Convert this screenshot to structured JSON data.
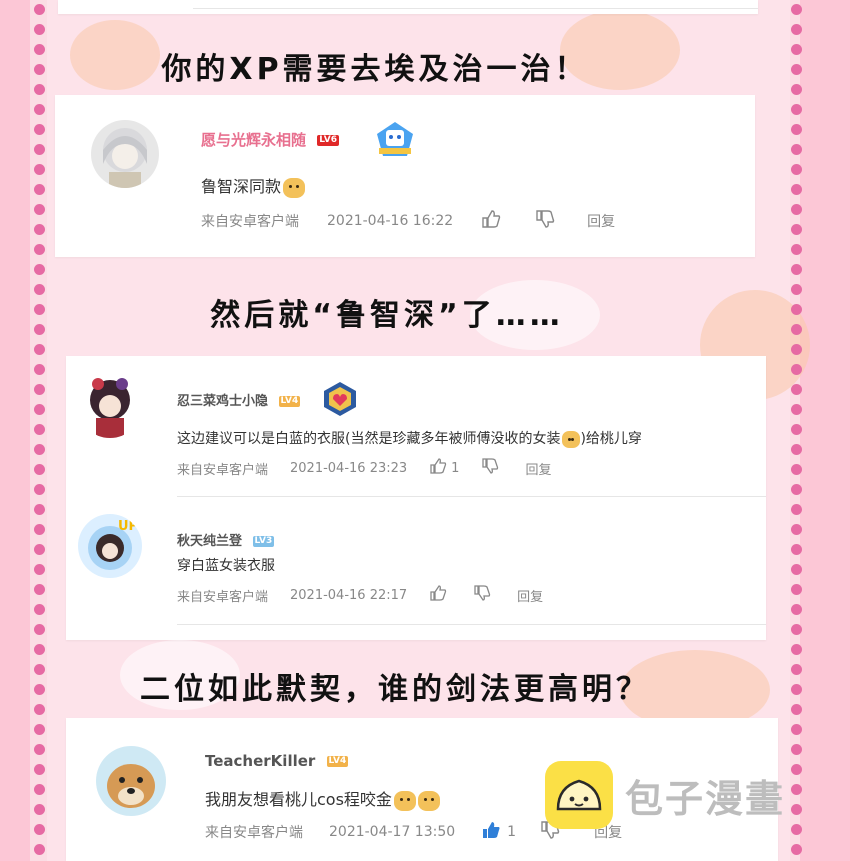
{
  "captions": {
    "c1": "你的XP需要去埃及治一治！",
    "c2": "然后就“鲁智深”了……",
    "c3": "二位如此默契，谁的剑法更高明？"
  },
  "comments": [
    {
      "username": "愿与光辉永相随",
      "level": "LV6",
      "text": "鲁智深同款",
      "source": "来自安卓客户端",
      "time": "2021-04-16 16:22",
      "likes": "",
      "reply": "回复"
    },
    {
      "username": "忍三菜鸡士小隐",
      "level": "LV4",
      "text": "这边建议可以是白蓝的衣服(当然是珍藏多年被师傅没收的女装",
      "text_tail": ")给桃儿穿",
      "source": "来自安卓客户端",
      "time": "2021-04-16 23:23",
      "likes": "1",
      "reply": "回复"
    },
    {
      "username": "秋天纯兰登",
      "level": "LV3",
      "text": "穿白蓝女装衣服",
      "source": "来自安卓客户端",
      "time": "2021-04-16 22:17",
      "likes": "",
      "reply": "回复"
    },
    {
      "username": "TeacherKiller",
      "level": "LV4",
      "text": "我朋友想看桃儿cos程咬金",
      "source": "来自安卓客户端",
      "time": "2021-04-17 13:50",
      "likes": "1",
      "reply": "回复"
    }
  ],
  "watermark": {
    "text": "包子漫畫"
  },
  "colors": {
    "border_pink": "#fcc7d6",
    "dot_pink": "#e66aa3",
    "username_pink": "#e8708f",
    "username_gray": "#555555",
    "lv_red": "#e02828",
    "lv_orange": "#f2b24a",
    "lv_blue": "#7fbfe8",
    "like_blue": "#2f7fd8"
  }
}
